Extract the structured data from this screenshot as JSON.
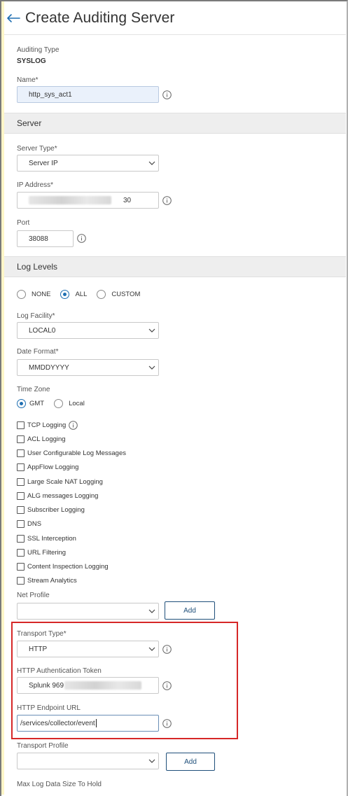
{
  "header": {
    "title": "Create Auditing Server"
  },
  "auditing_type": {
    "label": "Auditing Type",
    "value": "SYSLOG"
  },
  "name": {
    "label": "Name*",
    "value": "http_sys_act1"
  },
  "sections": {
    "server": "Server",
    "log_levels": "Log Levels"
  },
  "server_type": {
    "label": "Server Type*",
    "value": "Server IP"
  },
  "ip_address": {
    "label": "IP Address*",
    "value_suffix": "30"
  },
  "port": {
    "label": "Port",
    "value": "38088"
  },
  "log_levels": {
    "options": [
      {
        "label": "NONE",
        "checked": false
      },
      {
        "label": "ALL",
        "checked": true
      },
      {
        "label": "CUSTOM",
        "checked": false
      }
    ]
  },
  "log_facility": {
    "label": "Log Facility*",
    "value": "LOCAL0"
  },
  "date_format": {
    "label": "Date Format*",
    "value": "MMDDYYYY"
  },
  "time_zone": {
    "label": "Time Zone",
    "options": [
      {
        "label": "GMT",
        "checked": true
      },
      {
        "label": "Local",
        "checked": false
      }
    ]
  },
  "checkboxes": [
    "TCP Logging",
    "ACL Logging",
    "User Configurable Log Messages",
    "AppFlow Logging",
    "Large Scale NAT Logging",
    "ALG messages Logging",
    "Subscriber Logging",
    "DNS",
    "SSL Interception",
    "URL Filtering",
    "Content Inspection Logging",
    "Stream Analytics"
  ],
  "net_profile": {
    "label": "Net Profile",
    "value": "",
    "add_label": "Add"
  },
  "transport_type": {
    "label": "Transport Type*",
    "value": "HTTP"
  },
  "http_auth_token": {
    "label": "HTTP Authentication Token",
    "value_prefix": "Splunk 969"
  },
  "http_endpoint_url": {
    "label": "HTTP Endpoint URL",
    "value": "/services/collector/event"
  },
  "transport_profile": {
    "label": "Transport Profile",
    "value": "",
    "add_label": "Add"
  },
  "max_log_data": {
    "label": "Max Log Data Size To Hold"
  },
  "colors": {
    "accent": "#1f6fb2",
    "highlight": "#d62727",
    "section_bg": "#eeeeee"
  }
}
